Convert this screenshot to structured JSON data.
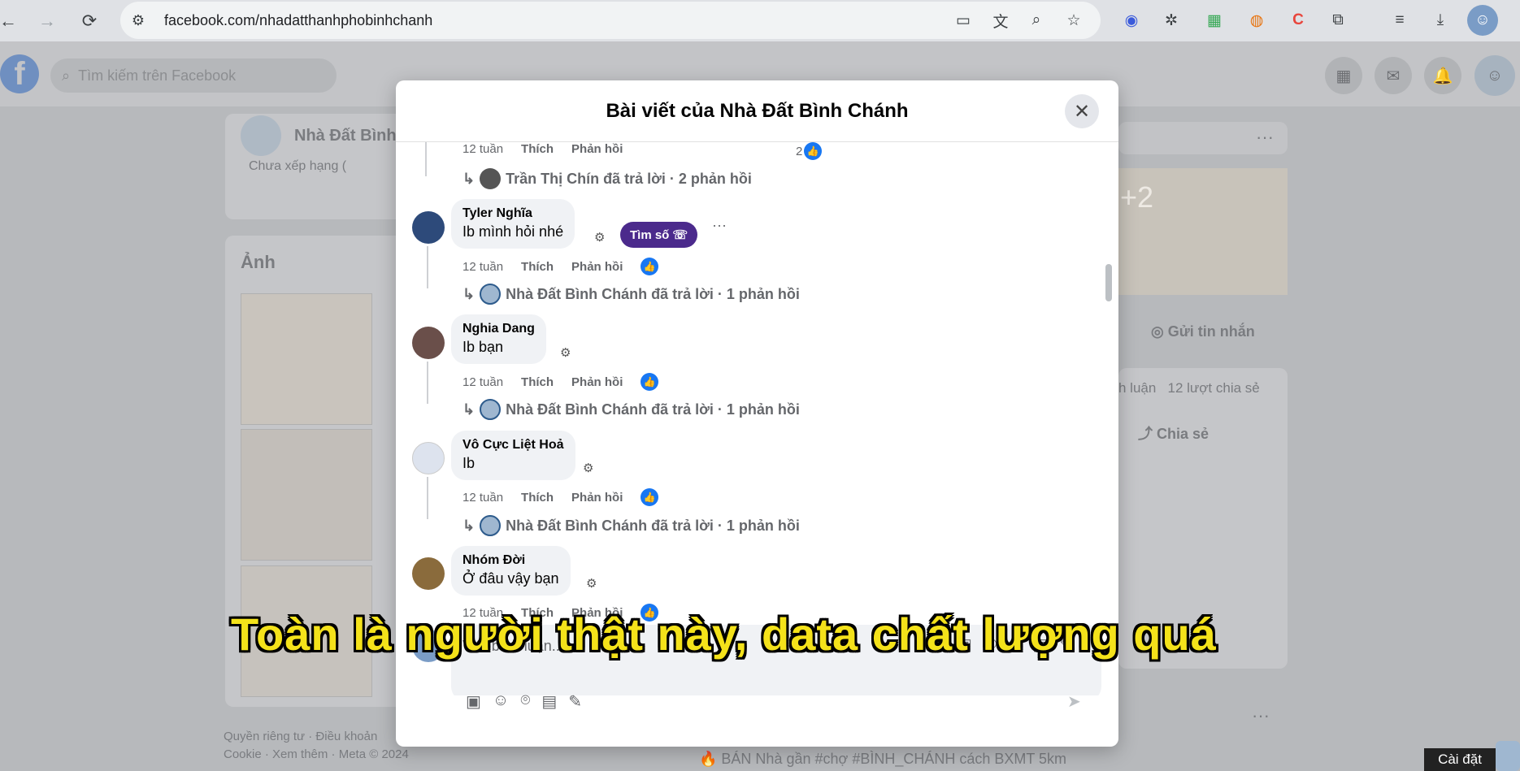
{
  "browser": {
    "url": "facebook.com/nhadatthanhphobinhchanh"
  },
  "fb": {
    "search_placeholder": "Tìm kiếm trên Facebook",
    "page_name": "Nhà Đất Bình",
    "page_sub": "Chưa xếp hạng (",
    "photos_title": "Ảnh",
    "photo_more": "+2",
    "send_message": "Gửi tin nhắn",
    "stats": "h luận   12 lượt chia sẻ",
    "share": "Chia sẻ",
    "footer1": "Quyền riêng tư · Điều khoản",
    "footer2": "Cookie · Xem thêm · Meta © 2024",
    "post_snippet": "BÁN Nhà gần #chợ #BÌNH_CHÁNH cách BXMT 5km"
  },
  "modal": {
    "title": "Bài viết của Nhà Đất Bình Chánh",
    "top": {
      "time": "12 tuần",
      "like": "Thích",
      "reply": "Phản hồi",
      "like_count": "2",
      "thread_reply": "Trần Thị Chín đã trả lời · 2 phản hồi"
    },
    "comments": [
      {
        "name": "Tyler Nghĩa",
        "text": "Ib mình hỏi nhé",
        "time": "12 tuần",
        "like": "Thích",
        "reply": "Phản hồi",
        "thread_reply": "Nhà Đất Bình Chánh đã trả lời · 1 phản hồi",
        "tag": "Tìm số"
      },
      {
        "name": "Nghia Dang",
        "text": "Ib bạn",
        "time": "12 tuần",
        "like": "Thích",
        "reply": "Phản hồi",
        "thread_reply": "Nhà Đất Bình Chánh đã trả lời · 1 phản hồi"
      },
      {
        "name": "Vô Cực Liệt Hoả",
        "text": "Ib",
        "time": "12 tuần",
        "like": "Thích",
        "reply": "Phản hồi",
        "thread_reply": "Nhà Đất Bình Chánh đã trả lời · 1 phản hồi"
      },
      {
        "name": "Nhóm Đời",
        "text": "Ở đâu vậy bạn",
        "time": "12 tuần",
        "like": "Thích",
        "reply": "Phản hồi"
      }
    ],
    "composer_placeholder": "Viết bình luận..."
  },
  "subtitle": "Toàn là người thật này, data chất lượng quá",
  "settings_tooltip": "Cài đặt",
  "colors": {
    "fb_blue": "#1877f2",
    "subtitle_yellow": "#f4e21a",
    "tag_purple": "#4b2a8c"
  }
}
